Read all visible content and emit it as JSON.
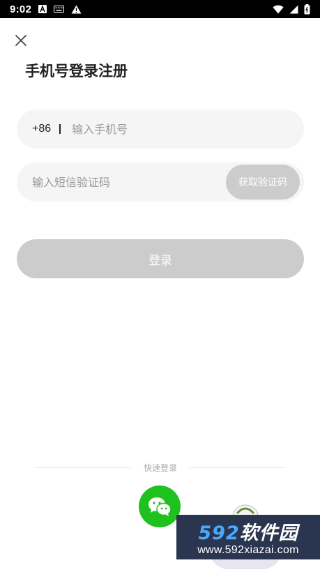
{
  "status_bar": {
    "time": "9:02",
    "icons_left": [
      "font-icon",
      "keyboard-icon",
      "alert-icon"
    ],
    "icons_right": [
      "wifi-icon",
      "signal-icon",
      "battery-icon"
    ]
  },
  "header": {
    "close_icon": "close-icon",
    "title": "手机号登录注册"
  },
  "phone": {
    "country_code": "+86",
    "placeholder": "输入手机号",
    "value": ""
  },
  "sms": {
    "placeholder": "输入短信验证码",
    "value": "",
    "get_code_label": "获取验证码"
  },
  "login": {
    "label": "登录"
  },
  "quick_login": {
    "label": "快速登录",
    "wechat_icon": "wechat-icon"
  },
  "watermark": {
    "number": "592",
    "text": "软件园",
    "url": "www.592xiazai.com"
  },
  "colors": {
    "wechat_green": "#1fc11f",
    "disabled_button": "#cccccc",
    "input_bg": "#f5f5f5"
  }
}
